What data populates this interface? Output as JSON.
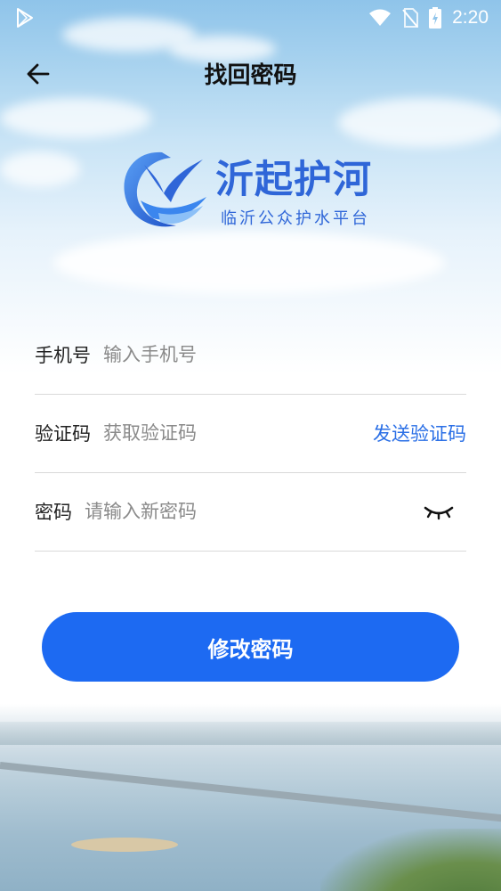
{
  "status_bar": {
    "time": "2:20",
    "icons": [
      "play-store-icon",
      "wifi-icon",
      "no-sim-icon",
      "battery-charging-icon"
    ]
  },
  "header": {
    "title": "找回密码",
    "back_icon": "arrow-left-icon"
  },
  "logo": {
    "name": "沂起护河",
    "subtitle": "临沂公众护水平台"
  },
  "form": {
    "phone": {
      "label": "手机号",
      "placeholder": "输入手机号",
      "value": ""
    },
    "code": {
      "label": "验证码",
      "placeholder": "获取验证码",
      "value": "",
      "send_label": "发送验证码"
    },
    "password": {
      "label": "密码",
      "placeholder": "请输入新密码",
      "value": "",
      "toggle_icon": "eye-closed-icon"
    },
    "submit_label": "修改密码"
  },
  "colors": {
    "accent": "#1d6af2",
    "link": "#2a6fe6",
    "logo_blue": "#2f66d8",
    "divider": "#d9d9d9"
  }
}
